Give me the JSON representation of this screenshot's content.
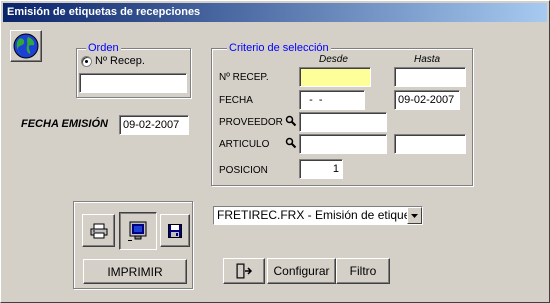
{
  "window": {
    "title": "Emisión de etiquetas de recepciones"
  },
  "orden": {
    "title": "Orden",
    "option_label": "Nº Recep.",
    "value": ""
  },
  "fecha_emision": {
    "label": "FECHA EMISIÓN",
    "value": "09-02-2007"
  },
  "criterio": {
    "title": "Criterio de selección",
    "desde_label": "Desde",
    "hasta_label": "Hasta",
    "rows": {
      "recep": {
        "label": "Nº RECEP.",
        "desde": "",
        "hasta": ""
      },
      "fecha": {
        "label": "FECHA",
        "desde": "  -  -",
        "hasta": "09-02-2007"
      },
      "proveedor": {
        "label": "PROVEEDOR",
        "desde": ""
      },
      "articulo": {
        "label": "ARTICULO",
        "desde": "",
        "hasta": ""
      },
      "posicion": {
        "label": "POSICION",
        "value": "1"
      }
    }
  },
  "output": {
    "report_select": "FRETIREC.FRX - Emisión de etique",
    "print_button": "IMPRIMIR",
    "configurar_button": "Configurar",
    "filtro_button": "Filtro"
  },
  "colors": {
    "title_start": "#0a246a",
    "title_end": "#a6caf0",
    "group_title": "#0000ff",
    "highlight_field": "#ffff99"
  }
}
